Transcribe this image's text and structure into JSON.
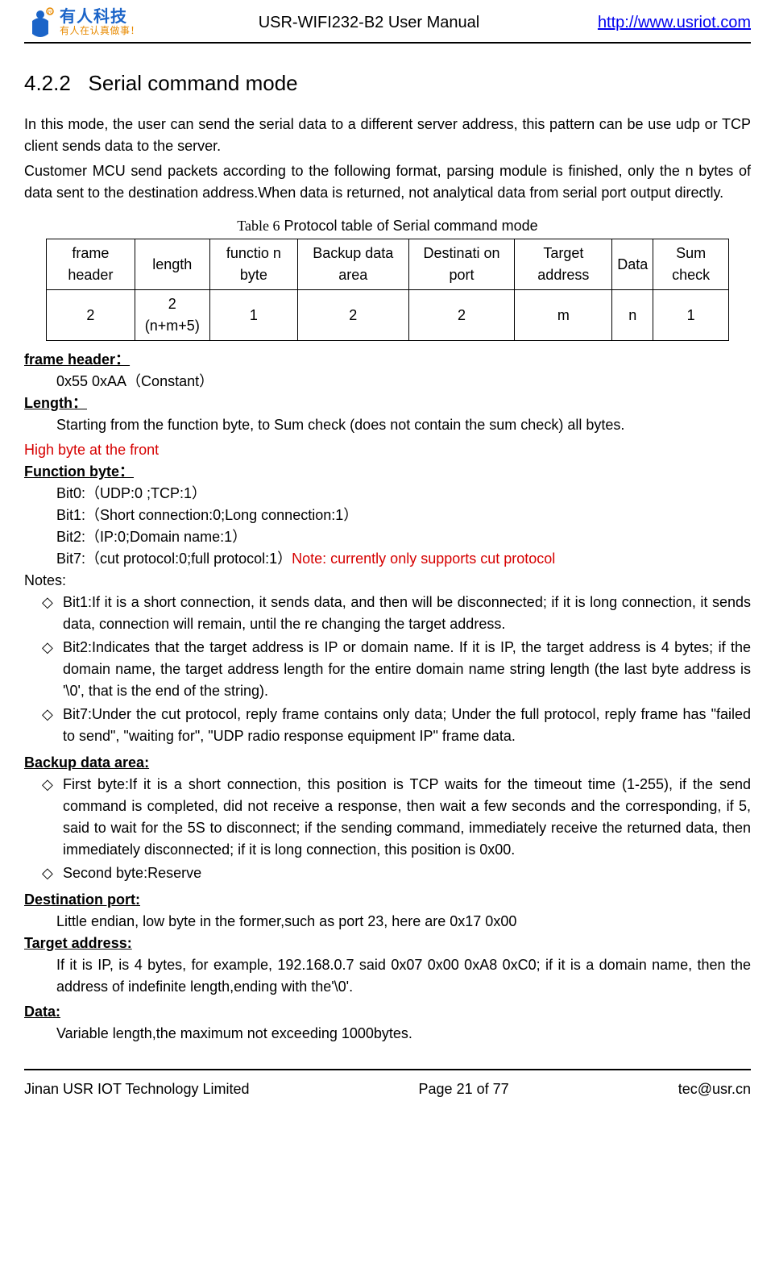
{
  "header": {
    "logo_cn_top": "有人科技",
    "logo_cn_bottom": "有人在认真做事！",
    "title": "USR-WIFI232-B2 User Manual",
    "link": "http://www.usriot.com"
  },
  "section": {
    "number": "4.2.2",
    "title": "Serial command mode"
  },
  "para1": "In this mode, the user can send the serial data to a different server address, this pattern can be use udp or TCP client sends data to the server.",
  "para2": "Customer MCU send packets according to the following format, parsing module is finished, only the n bytes of data sent to the destination address.When data is returned, not analytical data from serial port output directly.",
  "table_caption_prefix": "Table 6",
  "table_caption_rest": "  Protocol table of Serial command mode",
  "table": {
    "headers": [
      "frame header",
      "length",
      "functio n byte",
      "Backup data area",
      "Destinati on port",
      "Target address",
      "Data",
      "Sum check"
    ],
    "values": [
      "2",
      "2 (n+m+5)",
      "1",
      "2",
      "2",
      "m",
      "n",
      "1"
    ]
  },
  "frame_header_label": "frame header：",
  "frame_header_val": "0x55 0xAA（Constant）",
  "length_label": "Length：",
  "length_val": "Starting from the function byte, to Sum check (does not contain the sum check) all bytes. ",
  "length_red": "High byte at the front",
  "func_label": "Function byte：",
  "func_bit0": "Bit0:（UDP:0 ;TCP:1）",
  "func_bit1": "Bit1:（Short connection:0;Long connection:1）",
  "func_bit2": "Bit2:（IP:0;Domain name:1）",
  "func_bit7_a": "Bit7:（cut protocol:0;full protocol:1）",
  "func_bit7_b": "Note: currently only supports cut protocol",
  "notes_label": "Notes:",
  "note1": "Bit1:If it is a short connection, it sends data, and then will be disconnected; if it is long connection, it sends data, connection will remain, until the re changing the target address.",
  "note2": "Bit2:Indicates that the target address is IP or domain name. If it is IP, the target address is 4 bytes; if the domain name, the target address length for the entire domain name string length (the last byte address is '\\0', that is the end of the string).",
  "note3": "Bit7:Under the cut protocol, reply frame contains only data; Under the full protocol, reply frame has \"failed to send\", \"waiting for\", \"UDP radio response equipment IP\" frame data.",
  "backup_label": "Backup data area:",
  "backup1": "First byte:If it is a short connection, this position is TCP waits for the timeout time (1-255), if the send command is completed, did not receive a response, then wait a few seconds and the corresponding, if 5, said to wait for the 5S to disconnect; if the sending command, immediately receive the returned data, then immediately disconnected; if it is long connection, this position is 0x00.",
  "backup2": "Second byte:Reserve",
  "dest_label": "Destination port:",
  "dest_val": "Little endian, low byte in the former,such as port 23, here are 0x17 0x00",
  "target_label": "Target address:",
  "target_val": "If it is IP, is 4 bytes, for example, 192.168.0.7 said 0x07 0x00 0xA8 0xC0; if it is a domain name, then the address of  indefinite length,ending with the'\\0'.",
  "data_label": "Data:",
  "data_val": "Variable length,the maximum not exceeding 1000bytes.",
  "footer": {
    "left": "Jinan USR IOT Technology Limited",
    "center": "Page 21 of 77",
    "right": "tec@usr.cn"
  }
}
